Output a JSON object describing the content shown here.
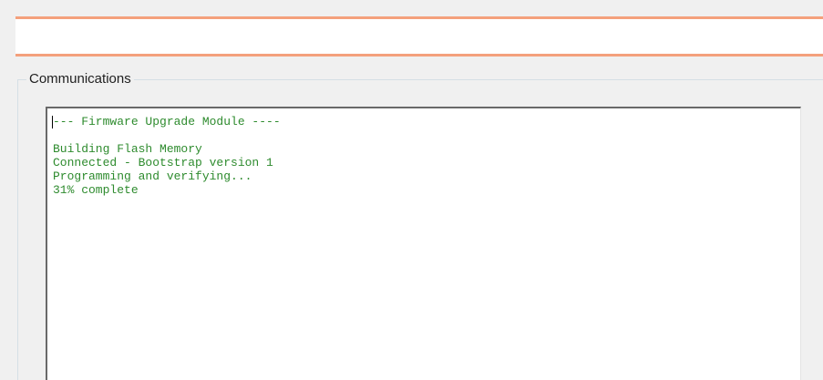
{
  "group": {
    "title": "Communications"
  },
  "console": {
    "lines": [
      "--- Firmware Upgrade Module ----",
      "",
      "Building Flash Memory",
      "Connected - Bootstrap version 1",
      "Programming and verifying...",
      "31% complete"
    ]
  },
  "colors": {
    "accent_line": "#f4a07c",
    "console_text": "#2e8b2e"
  }
}
